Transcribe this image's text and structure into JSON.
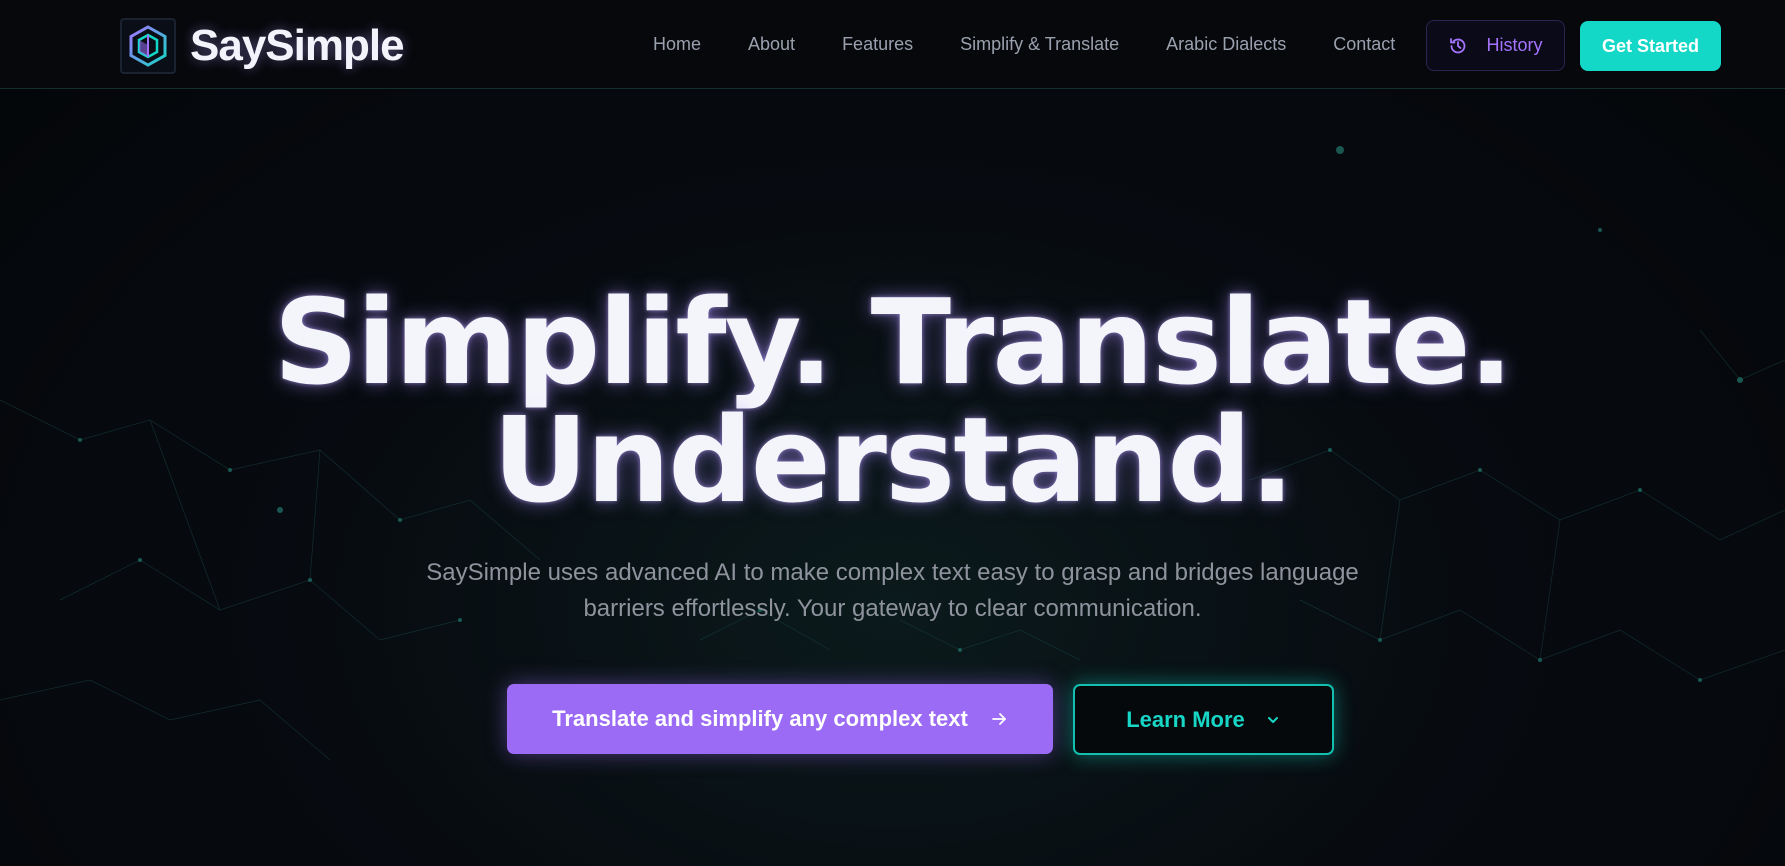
{
  "brand": {
    "name": "SaySimple",
    "logo_icon": "hexagon-cube-logo"
  },
  "nav": {
    "links": [
      {
        "label": "Home"
      },
      {
        "label": "About"
      },
      {
        "label": "Features"
      },
      {
        "label": "Simplify & Translate"
      },
      {
        "label": "Arabic Dialects"
      },
      {
        "label": "Contact"
      }
    ],
    "history": {
      "label": "History",
      "icon": "history-clock-icon"
    },
    "get_started": {
      "label": "Get Started"
    }
  },
  "hero": {
    "title_line1": "Simplify. Translate.",
    "title_line2": "Understand.",
    "subtitle_line1": "SaySimple uses advanced AI to make complex text easy to grasp and bridges language",
    "subtitle_line2": "barriers effortlessly. Your gateway to clear communication.",
    "primary_cta": {
      "label": "Translate and simplify any complex text",
      "icon": "arrow-right-icon"
    },
    "secondary_cta": {
      "label": "Learn More",
      "icon": "chevron-down-icon"
    }
  },
  "colors": {
    "accent_purple": "#9b6bf6",
    "accent_teal": "#14d8c7",
    "background": "#05070b",
    "title_text": "#f4f4fb"
  }
}
